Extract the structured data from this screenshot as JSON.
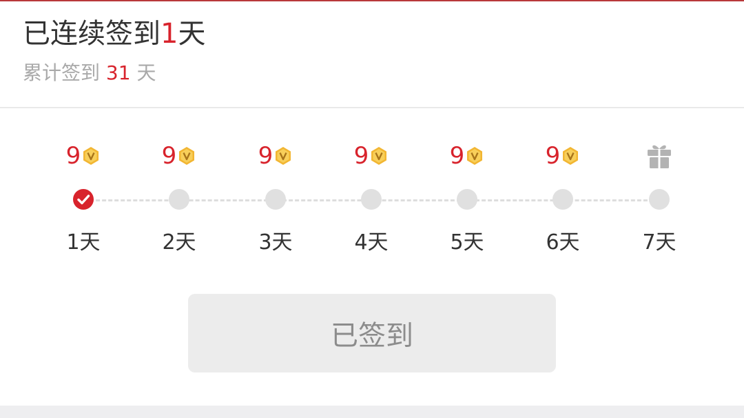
{
  "streak": {
    "prefix": "已连续签到",
    "days": "1",
    "suffix": "天"
  },
  "total": {
    "prefix": "累计签到",
    "days": "31",
    "suffix": "天"
  },
  "days": [
    {
      "label": "1天",
      "reward": "9",
      "reward_icon": "v-coin-icon",
      "checked": true
    },
    {
      "label": "2天",
      "reward": "9",
      "reward_icon": "v-coin-icon",
      "checked": false
    },
    {
      "label": "3天",
      "reward": "9",
      "reward_icon": "v-coin-icon",
      "checked": false
    },
    {
      "label": "4天",
      "reward": "9",
      "reward_icon": "v-coin-icon",
      "checked": false
    },
    {
      "label": "5天",
      "reward": "9",
      "reward_icon": "v-coin-icon",
      "checked": false
    },
    {
      "label": "6天",
      "reward": "9",
      "reward_icon": "v-coin-icon",
      "checked": false
    },
    {
      "label": "7天",
      "reward": "",
      "reward_icon": "gift-icon",
      "checked": false
    }
  ],
  "signin_button": {
    "label": "已签到",
    "enabled": false
  },
  "colors": {
    "accent_red": "#d8232c",
    "coin_gold": "#f2b632",
    "inactive_dot": "#e0e0e0",
    "gift_gray": "#b3b3b3"
  }
}
